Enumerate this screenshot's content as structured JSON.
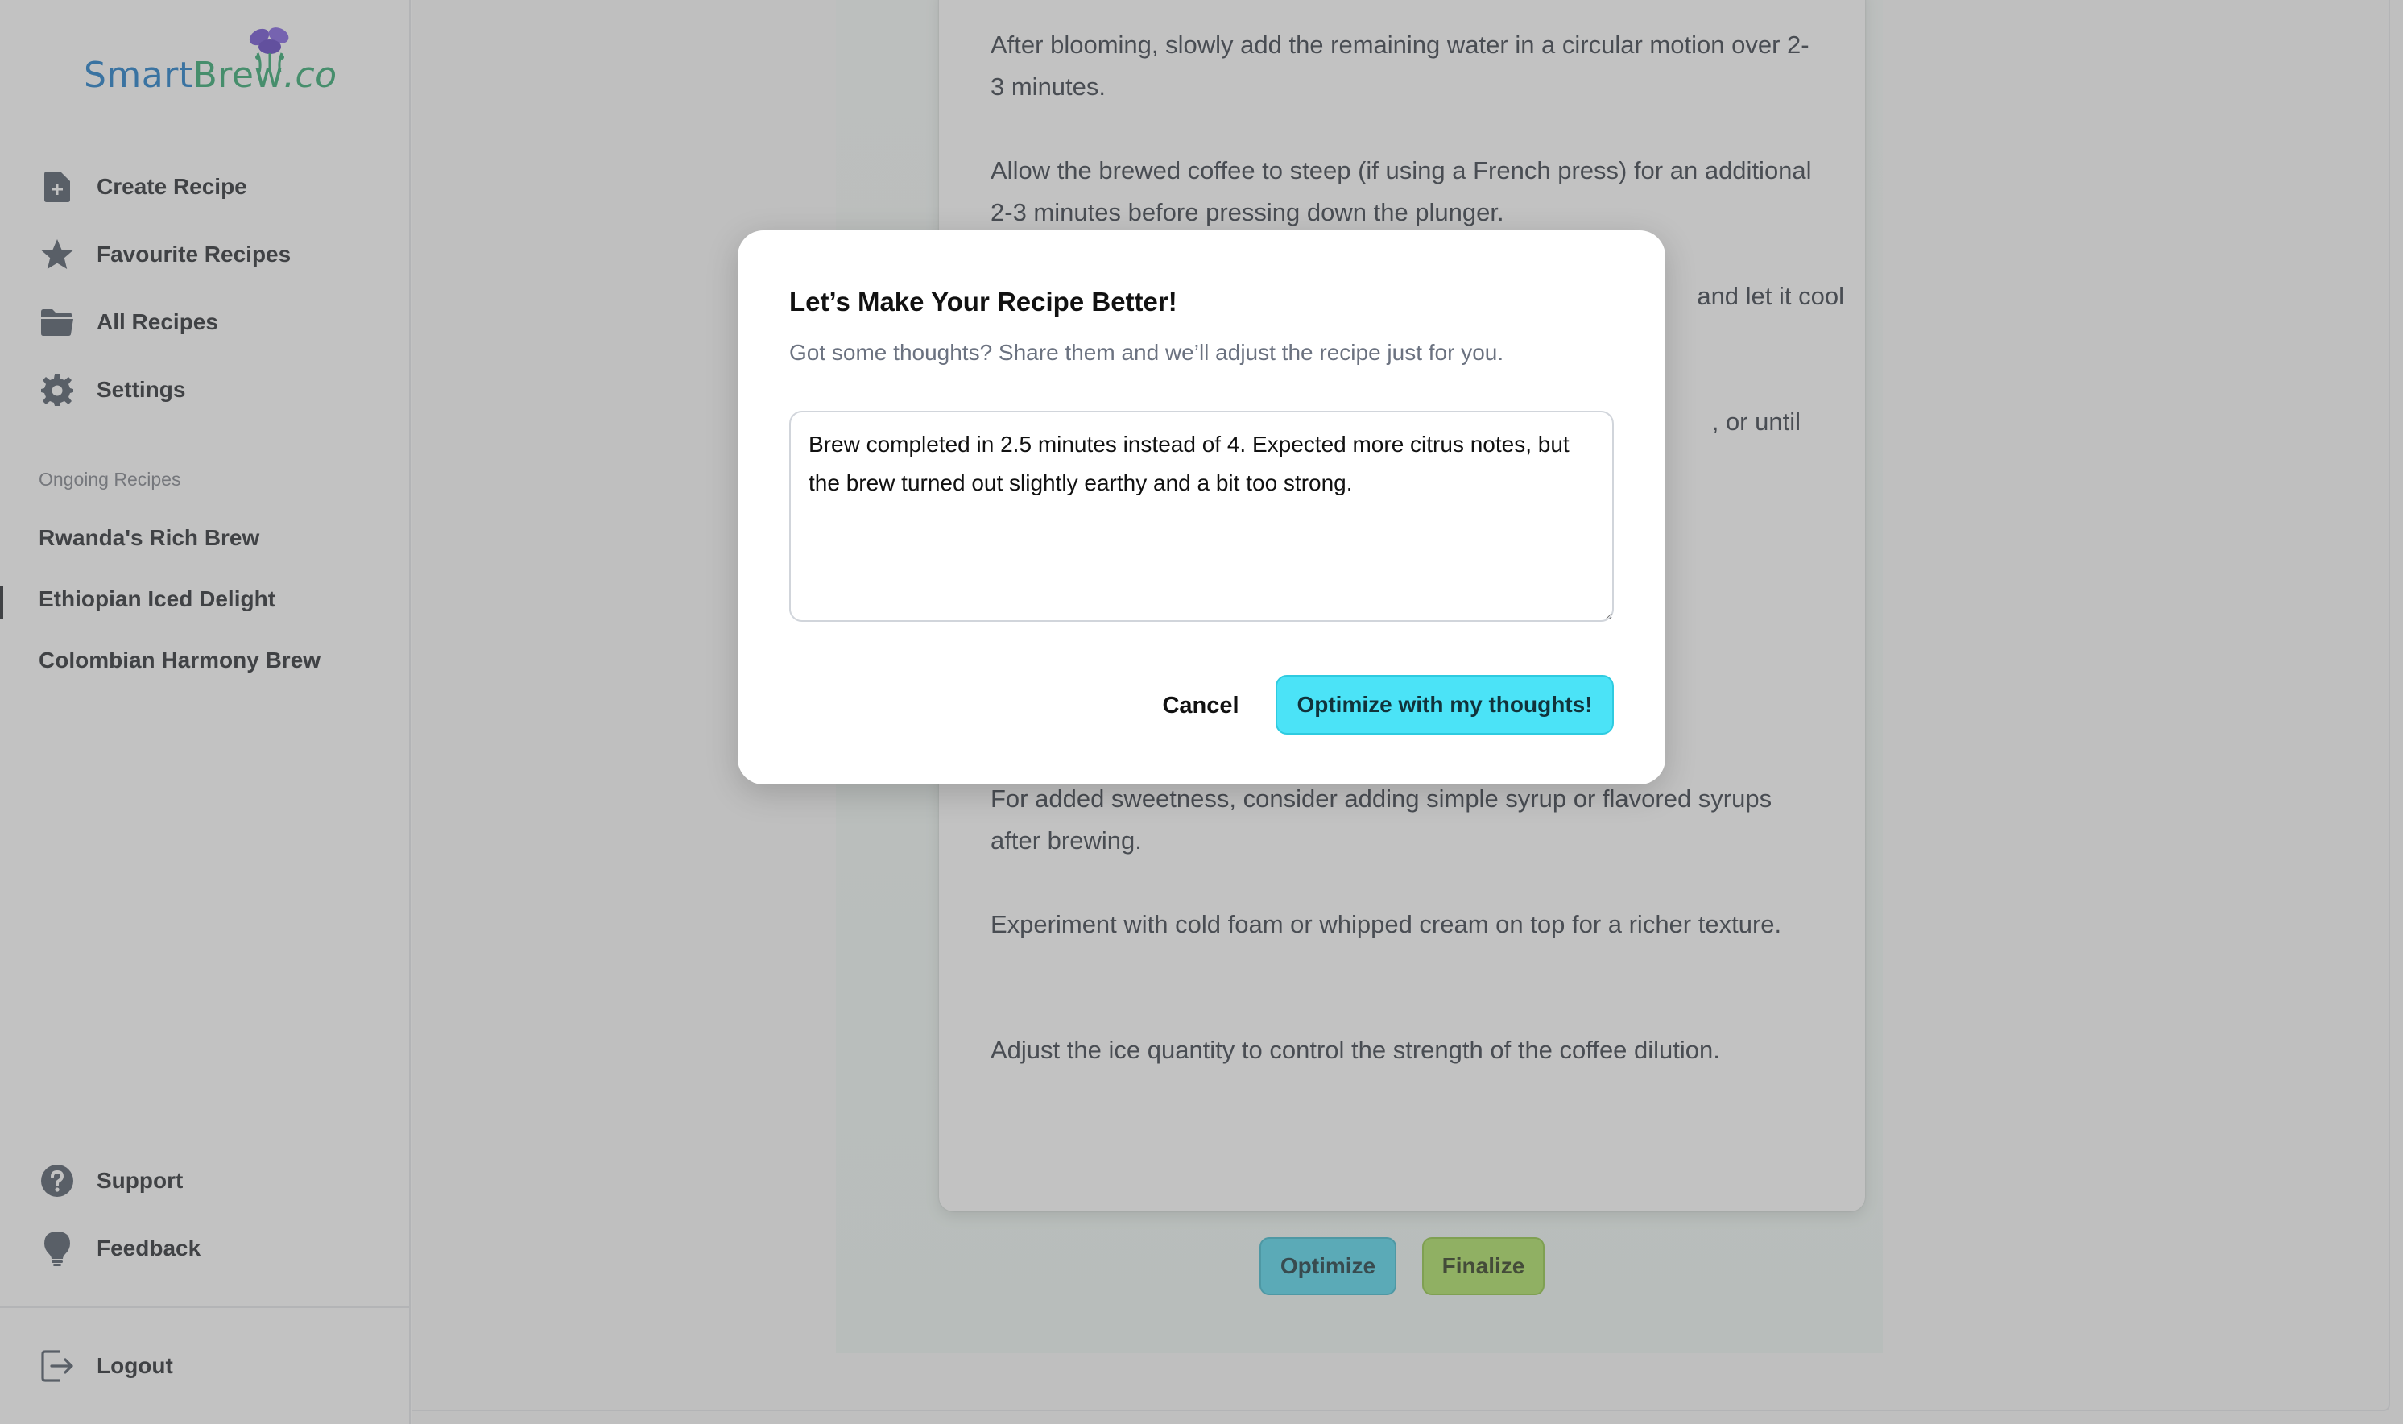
{
  "brand": {
    "part1": "Smart",
    "part2": "Brew",
    "part3": ".co"
  },
  "sidebar": {
    "nav": [
      {
        "label": "Create Recipe",
        "icon": "file-plus-icon"
      },
      {
        "label": "Favourite Recipes",
        "icon": "star-icon"
      },
      {
        "label": "All Recipes",
        "icon": "folder-icon"
      },
      {
        "label": "Settings",
        "icon": "gear-icon"
      }
    ],
    "section_label": "Ongoing Recipes",
    "ongoing": [
      {
        "label": "Rwanda's Rich Brew",
        "active": false
      },
      {
        "label": "Ethiopian Iced Delight",
        "active": true
      },
      {
        "label": "Colombian Harmony Brew",
        "active": false
      }
    ],
    "bottom": [
      {
        "label": "Support",
        "icon": "question-circle-icon"
      },
      {
        "label": "Feedback",
        "icon": "lightbulb-icon"
      }
    ],
    "logout": {
      "label": "Logout",
      "icon": "logout-icon"
    }
  },
  "recipe": {
    "paragraphs": [
      "After blooming, slowly add the remaining water in a circular motion over 2-3 minutes.",
      "Allow the brewed coffee to steep (if using a French press) for an additional 2-3 minutes before pressing down the plunger.",
      "and let it cool",
      ", or until",
      "For added sweetness, consider adding simple syrup or flavored syrups after brewing.",
      "Experiment with cold foam or whipped cream on top for a richer texture.",
      "Adjust the ice quantity to control the strength of the coffee dilution."
    ],
    "optimize_label": "Optimize",
    "finalize_label": "Finalize"
  },
  "modal": {
    "title": "Let’s Make Your Recipe Better!",
    "subtitle": "Got some thoughts? Share them and we’ll adjust the recipe just for you.",
    "feedback_value": "Brew completed in 2.5 minutes instead of 4. Expected more citrus notes, but the brew turned out slightly earthy and a bit too strong.",
    "cancel_label": "Cancel",
    "submit_label": "Optimize with my thoughts!"
  },
  "colors": {
    "accent_cyan": "#4be3f7",
    "accent_green": "#a9e05c",
    "brand_blue": "#1677c7",
    "brand_green": "#2aa56b"
  }
}
